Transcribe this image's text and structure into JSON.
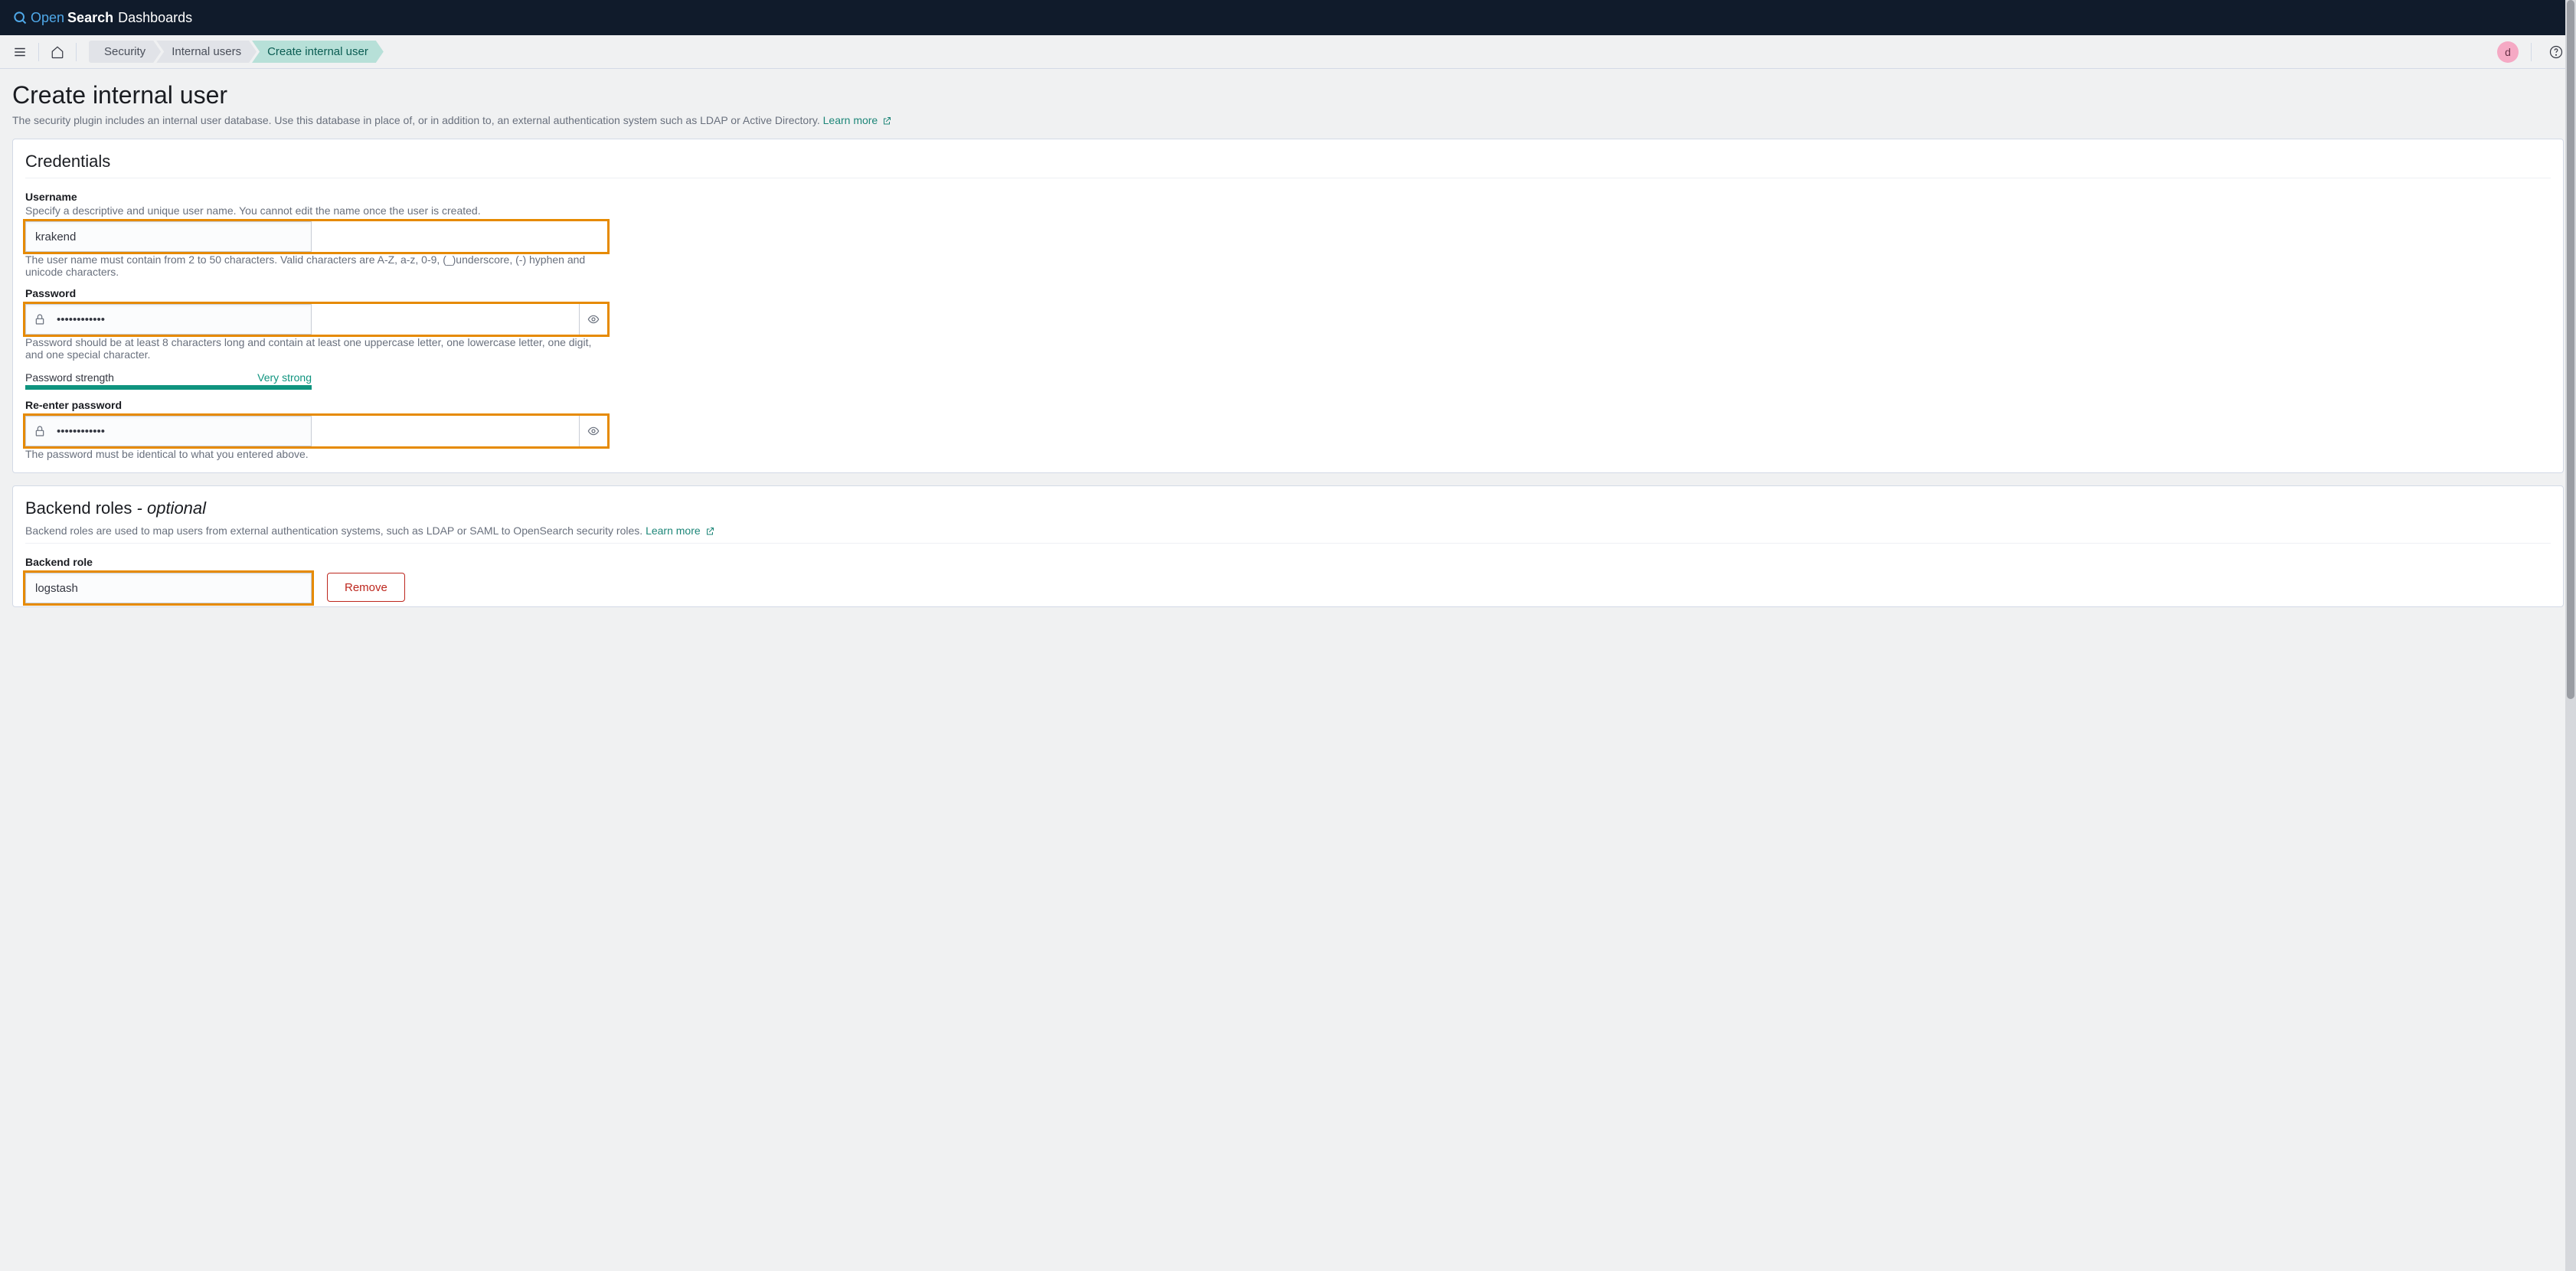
{
  "brand": {
    "open": "Open",
    "search": "Search",
    "dash": "Dashboards"
  },
  "nav": {
    "breadcrumbs": [
      "Security",
      "Internal users",
      "Create internal user"
    ],
    "avatar_initial": "d"
  },
  "page": {
    "title": "Create internal user",
    "desc": "The security plugin includes an internal user database. Use this database in place of, or in addition to, an external authentication system such as LDAP or Active Directory. ",
    "learn_more": "Learn more"
  },
  "credentials": {
    "title": "Credentials",
    "username_label": "Username",
    "username_hint": "Specify a descriptive and unique user name. You cannot edit the name once the user is created.",
    "username_value": "krakend",
    "username_help": "The user name must contain from 2 to 50 characters. Valid characters are A-Z, a-z, 0-9, (_)underscore, (-) hyphen and unicode characters.",
    "password_label": "Password",
    "password_value": "••••••••••••",
    "password_help": "Password should be at least 8 characters long and contain at least one uppercase letter, one lowercase letter, one digit, and one special character.",
    "strength_label": "Password strength",
    "strength_value": "Very strong",
    "reenter_label": "Re-enter password",
    "reenter_value": "••••••••••••",
    "reenter_help": "The password must be identical to what you entered above."
  },
  "backend": {
    "title_prefix": "Backend roles ",
    "title_suffix": "- optional",
    "desc": "Backend roles are used to map users from external authentication systems, such as LDAP or SAML to OpenSearch security roles. ",
    "learn_more": "Learn more",
    "role_label": "Backend role",
    "role_value": "logstash",
    "remove": "Remove"
  }
}
